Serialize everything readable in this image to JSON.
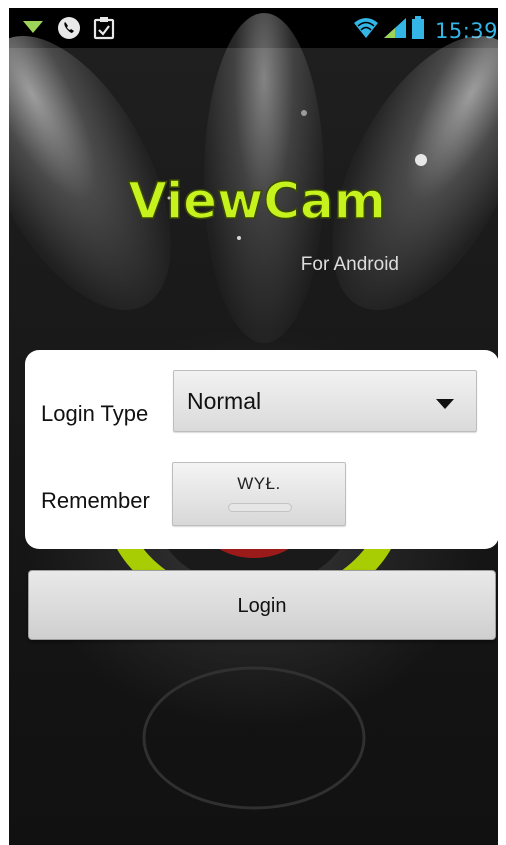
{
  "status_bar": {
    "time": "15:39",
    "left_icons": [
      "download-notification-icon",
      "phone-icon",
      "clipboard-icon"
    ],
    "right_icons": [
      "wifi-icon",
      "signal-icon",
      "battery-icon"
    ],
    "accent_color": "#33b5e5"
  },
  "branding": {
    "app_name": "ViewCam",
    "tagline": "For Android",
    "logo_color": "#c6f21d"
  },
  "form": {
    "login_type_label": "Login Type",
    "login_type_value": "Normal",
    "remember_label": "Remember",
    "remember_state": "WYŁ."
  },
  "actions": {
    "login_label": "Login"
  }
}
